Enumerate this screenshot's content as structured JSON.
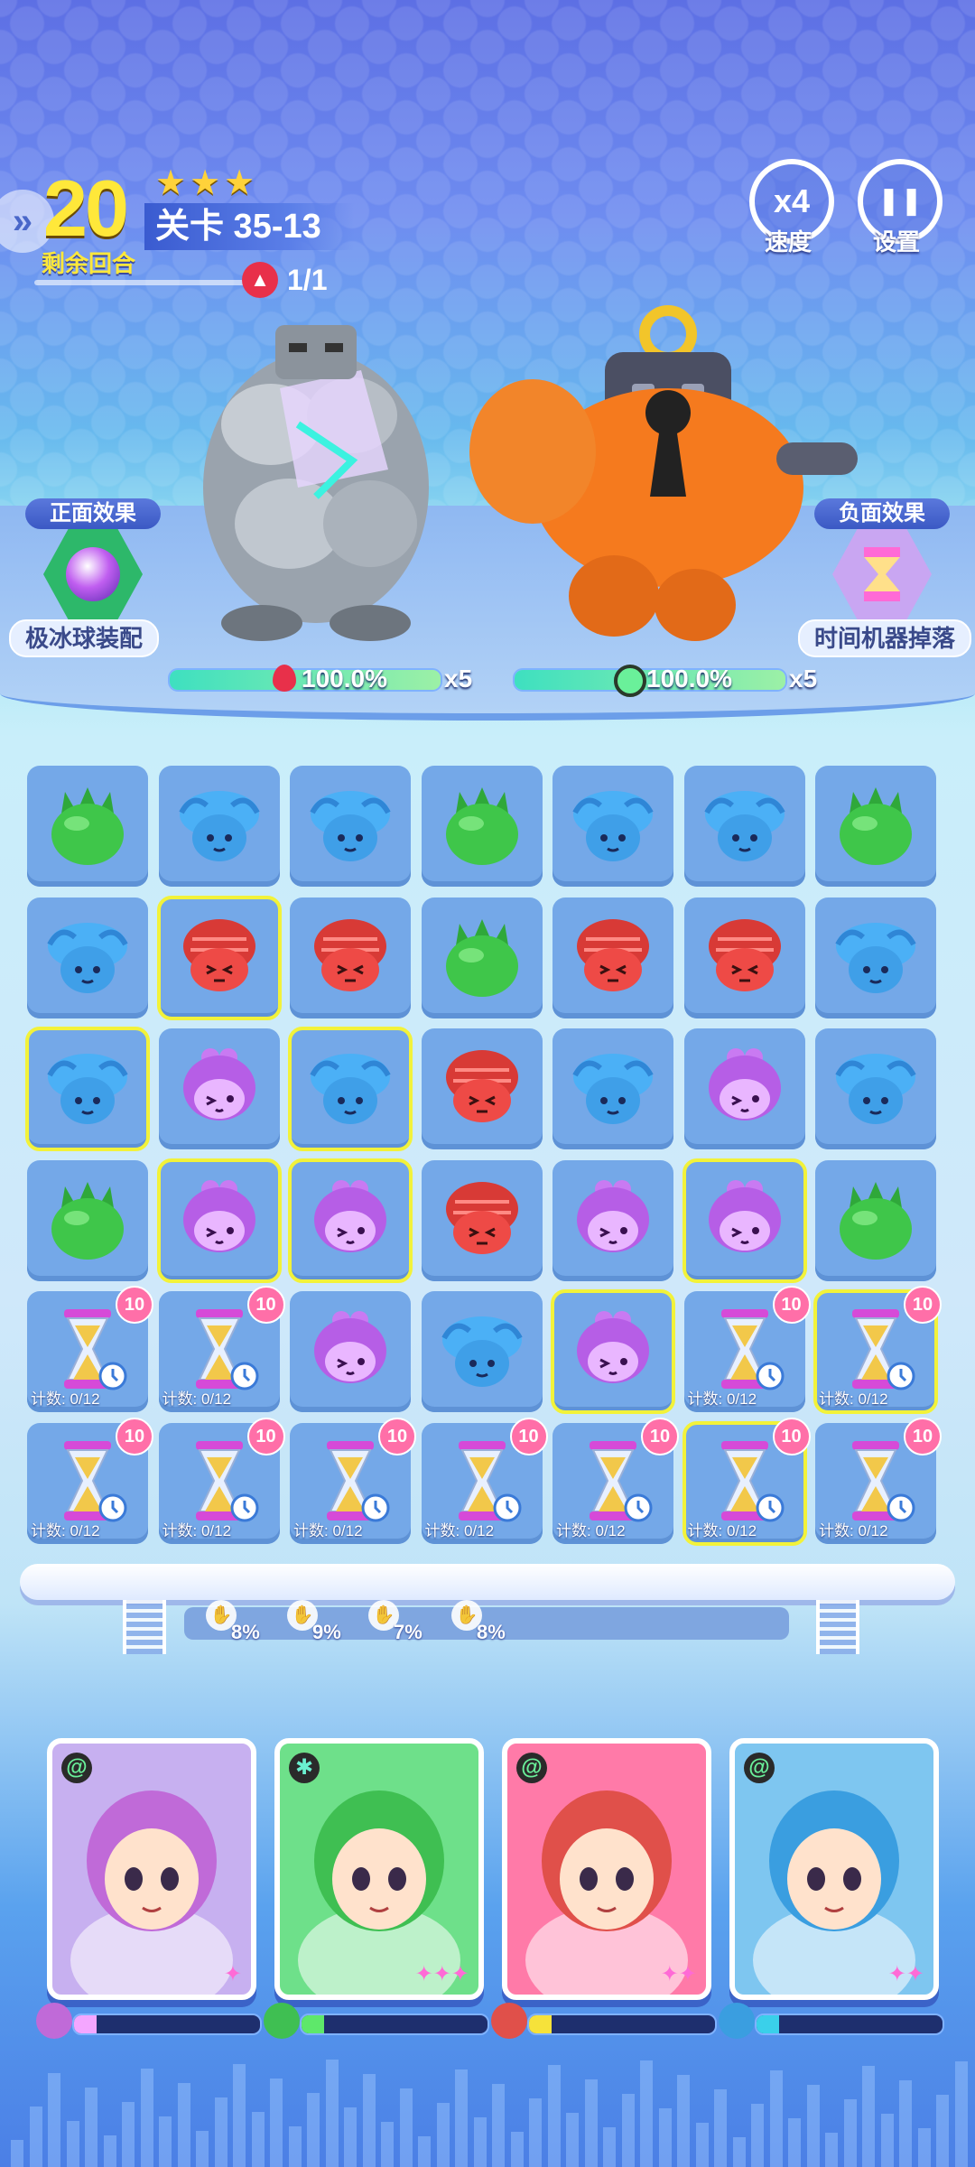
{
  "hud": {
    "turns_left": "20",
    "turns_label": "剩余回合",
    "stars": "★★★",
    "stage": "关卡 35-13",
    "wave": "1/1",
    "expand_glyph": "»"
  },
  "controls": {
    "speed_value": "x4",
    "speed_label": "速度",
    "pause_glyph": "❚❚",
    "settings_label": "设置"
  },
  "effects": {
    "positive_title": "正面效果",
    "positive_name": "极冰球装配",
    "negative_title": "负面效果",
    "negative_name": "时间机器掉落"
  },
  "enemies": [
    {
      "name_icon": "rock-golem",
      "hp_text": "100.0%",
      "hp_fraction": 1.0,
      "multiplier": "x5",
      "element_icon": "fire-drop-icon"
    },
    {
      "name_icon": "orange-robot",
      "hp_text": "100.0%",
      "hp_fraction": 1.0,
      "multiplier": "x5",
      "element_icon": "swirl-icon"
    }
  ],
  "board": {
    "rows": [
      [
        "green",
        "blue",
        "blue",
        "green",
        "blue",
        "blue",
        "green"
      ],
      [
        "blue",
        "red",
        "red",
        "green",
        "red",
        "red",
        "blue"
      ],
      [
        "blue",
        "purple",
        "blue",
        "red",
        "blue",
        "purple",
        "blue"
      ],
      [
        "green",
        "purple",
        "purple",
        "red",
        "purple",
        "purple",
        "green"
      ],
      [
        "hourglass",
        "hourglass",
        "purple",
        "blue",
        "purple",
        "hourglass",
        "hourglass"
      ],
      [
        "hourglass",
        "hourglass",
        "hourglass",
        "hourglass",
        "hourglass",
        "hourglass",
        "hourglass"
      ]
    ],
    "selected": [
      [
        1,
        1
      ],
      [
        2,
        0
      ],
      [
        2,
        2
      ],
      [
        3,
        1
      ],
      [
        3,
        2
      ],
      [
        3,
        5
      ],
      [
        4,
        4
      ],
      [
        4,
        6
      ],
      [
        5,
        5
      ]
    ],
    "hourglass_badge": "10",
    "hourglass_count": "计数: 0/12"
  },
  "rates": [
    "8%",
    "9%",
    "7%",
    "8%"
  ],
  "heroes": [
    {
      "name": "elf-girl-hero",
      "bg": "#c7b0f0",
      "element": "@",
      "element_color": "#6af09a",
      "stars": "✦",
      "charge_fraction": 0.12,
      "charge_color": "#f4a6ff",
      "head_color": "#c06ad8"
    },
    {
      "name": "robot-bunny-hero",
      "bg": "#6ee08a",
      "element": "✱",
      "element_color": "#6af0d0",
      "stars": "✦✦✦",
      "charge_fraction": 0.12,
      "charge_color": "#5ee86a",
      "head_color": "#3fbf52"
    },
    {
      "name": "maid-girl-hero",
      "bg": "#ff7aa8",
      "element": "@",
      "element_color": "#6af09a",
      "stars": "✦✦",
      "charge_fraction": 0.12,
      "charge_color": "#f6e23a",
      "head_color": "#e0504a"
    },
    {
      "name": "dragon-boy-hero",
      "bg": "#7ec6f0",
      "element": "@",
      "element_color": "#6af09a",
      "stars": "✦✦",
      "charge_fraction": 0.12,
      "charge_color": "#3ad0ea",
      "head_color": "#3a9ee0"
    }
  ],
  "colors": {
    "green": "#3fc64a",
    "blue": "#3f9fe8",
    "red": "#ee4a46",
    "purple": "#b65ee6",
    "selection": "#f2f23a"
  }
}
